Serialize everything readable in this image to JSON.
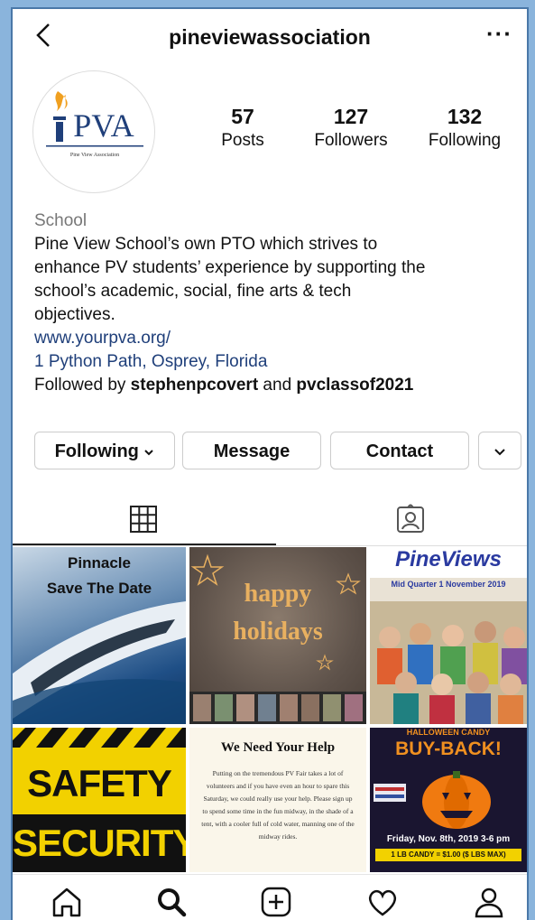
{
  "header": {
    "username": "pineviewassociation",
    "back_icon": "chevron-left-icon",
    "more_label": "···"
  },
  "profile": {
    "avatar_text": "PVA",
    "avatar_subtitle": "Pine View Association",
    "posts": "57",
    "posts_label": "Posts",
    "followers": "127",
    "followers_label": "Followers",
    "following": "132",
    "following_label": "Following"
  },
  "bio": {
    "category": "School",
    "line1": "Pine View School’s own PTO which strives to",
    "line2": "enhance PV students’ experience by supporting the",
    "line3": "school’s academic, social, fine arts & tech",
    "line4": "objectives.",
    "website": "www.yourpva.org/",
    "address": "1 Python Path, Osprey, Florida",
    "followed_prefix": "Followed by ",
    "followed_user1": "stephenpcovert",
    "followed_and": " and ",
    "followed_user2": "pvclassof2021"
  },
  "actions": {
    "following_label": "Following",
    "message_label": "Message",
    "contact_label": "Contact"
  },
  "posts": [
    {
      "title": "Pinnacle",
      "subtitle": "Save The Date"
    },
    {
      "title": "happy",
      "subtitle": "holidays"
    },
    {
      "title": "PineViews",
      "subtitle": "Mid Quarter 1 November 2019"
    },
    {
      "title": "SAFETY",
      "subtitle": "SECURITY"
    },
    {
      "title": "We Need Your Help",
      "subtitle": "Putting on the tremendous PV Fair takes a lot of volunteers and if you have even an hour to spare this Saturday, we could really use your help. Please sign up to spend some time in the fun midway, in the shade of a tent, with a cooler full of cold water, manning one of the midway rides."
    },
    {
      "title": "HALLOWEEN CANDY",
      "subtitle": "BUY-BACK!",
      "footer": "Friday, Nov. 8th, 2019 3-6 pm",
      "footer2": "1 LB CANDY = $1.00 ($ LBS MAX)"
    }
  ],
  "colors": {
    "link": "#1f3f7a",
    "frame": "#8ab4dc",
    "safety_yellow": "#f2d100"
  }
}
